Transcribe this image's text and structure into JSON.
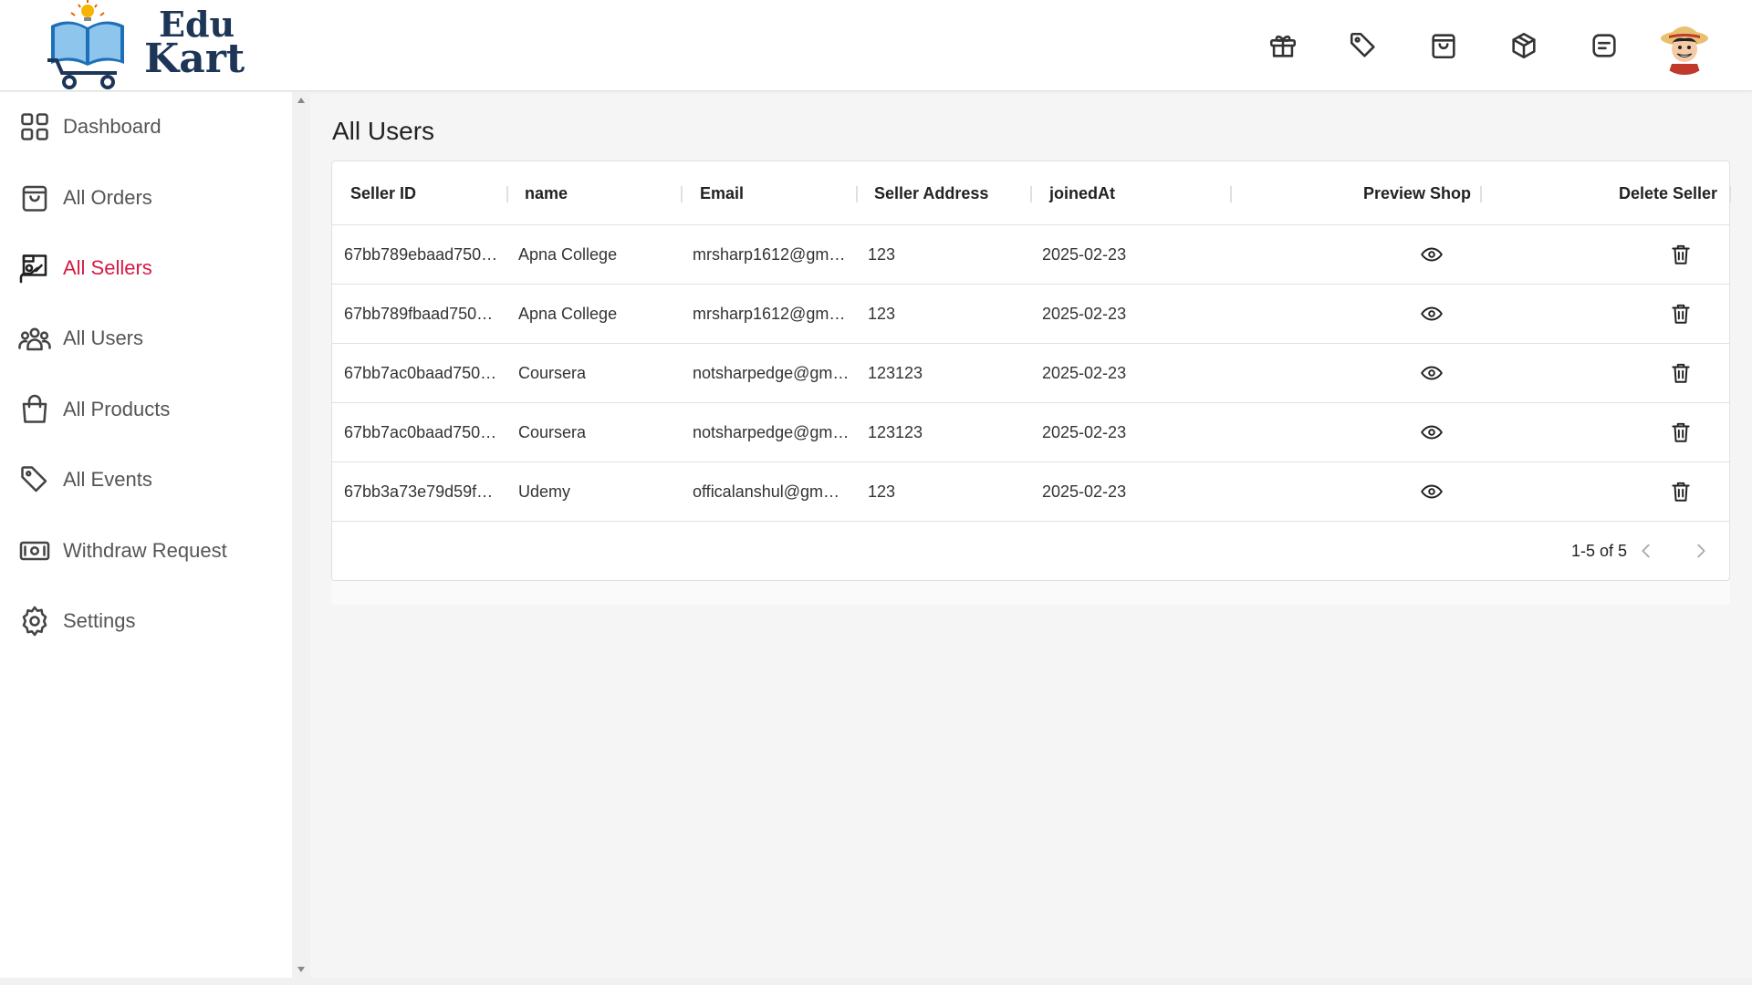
{
  "header": {
    "logo": {
      "line1": "Edu",
      "line2": "Kart"
    },
    "icons": [
      "gift-icon",
      "tag-icon",
      "shopping-bag-icon",
      "package-icon",
      "message-icon"
    ]
  },
  "sidebar": {
    "items": [
      {
        "label": "Dashboard",
        "icon": "dashboard-icon"
      },
      {
        "label": "All Orders",
        "icon": "bag-icon"
      },
      {
        "label": "All Sellers",
        "icon": "sellers-icon",
        "active": true
      },
      {
        "label": "All Users",
        "icon": "users-icon"
      },
      {
        "label": "All Products",
        "icon": "shopping-bag-icon"
      },
      {
        "label": "All Events",
        "icon": "tag-icon"
      },
      {
        "label": "Withdraw Request",
        "icon": "cash-icon"
      },
      {
        "label": "Settings",
        "icon": "settings-icon"
      }
    ],
    "active_color": "#d61b45"
  },
  "main": {
    "title": "All Users",
    "table": {
      "columns": [
        "Seller ID",
        "name",
        "Email",
        "Seller Address",
        "joinedAt",
        "Preview Shop",
        "Delete Seller"
      ],
      "rows": [
        {
          "id": "67bb789ebaad750…",
          "name": "Apna College",
          "email": "mrsharp1612@gm…",
          "address": "123",
          "joined": "2025-02-23"
        },
        {
          "id": "67bb789fbaad750…",
          "name": "Apna College",
          "email": "mrsharp1612@gm…",
          "address": "123",
          "joined": "2025-02-23"
        },
        {
          "id": "67bb7ac0baad750…",
          "name": "Coursera",
          "email": "notsharpedge@gm…",
          "address": "123123",
          "joined": "2025-02-23"
        },
        {
          "id": "67bb7ac0baad750…",
          "name": "Coursera",
          "email": "notsharpedge@gm…",
          "address": "123123",
          "joined": "2025-02-23"
        },
        {
          "id": "67bb3a73e79d59f…",
          "name": "Udemy",
          "email": "officalanshul@gm…",
          "address": "123",
          "joined": "2025-02-23"
        }
      ],
      "pagination": "1-5 of 5"
    }
  }
}
